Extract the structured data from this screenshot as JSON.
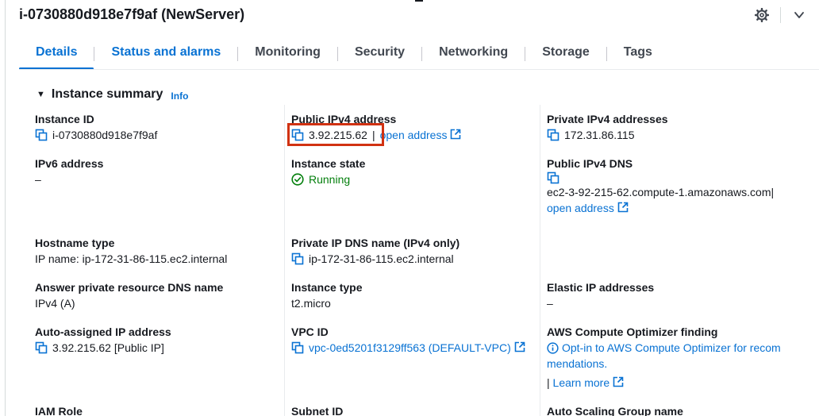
{
  "header": {
    "title": "i-0730880d918e7f9af (NewServer)",
    "settings_icon": "gear-icon",
    "expand_icon": "chevron-down-icon"
  },
  "tabs": [
    {
      "label": "Details",
      "active": true
    },
    {
      "label": "Status and alarms"
    },
    {
      "label": "Monitoring"
    },
    {
      "label": "Security"
    },
    {
      "label": "Networking"
    },
    {
      "label": "Storage"
    },
    {
      "label": "Tags"
    }
  ],
  "summary": {
    "title": "Instance summary",
    "info": "Info"
  },
  "fields": {
    "instance_id": {
      "label": "Instance ID",
      "value": "i-0730880d918e7f9af"
    },
    "public_ipv4": {
      "label": "Public IPv4 address",
      "value": "3.92.215.62",
      "sep": "|",
      "link": "open address"
    },
    "private_ipv4": {
      "label": "Private IPv4 addresses",
      "value": "172.31.86.115"
    },
    "ipv6": {
      "label": "IPv6 address",
      "value": "–"
    },
    "instance_state": {
      "label": "Instance state",
      "value": "Running"
    },
    "public_dns": {
      "label": "Public IPv4 DNS",
      "value": "ec2-3-92-215-62.compute-1.amazonaws.com",
      "sep": "|",
      "link": "open address"
    },
    "hostname_type": {
      "label": "Hostname type",
      "value": "IP name: ip-172-31-86-115.ec2.internal"
    },
    "private_dns": {
      "label": "Private IP DNS name (IPv4 only)",
      "value": "ip-172-31-86-115.ec2.internal"
    },
    "answer_dns": {
      "label": "Answer private resource DNS name",
      "value": "IPv4 (A)"
    },
    "instance_type": {
      "label": "Instance type",
      "value": "t2.micro"
    },
    "elastic_ip": {
      "label": "Elastic IP addresses",
      "value": "–"
    },
    "auto_ip": {
      "label": "Auto-assigned IP address",
      "value": "3.92.215.62 [Public IP]"
    },
    "vpc_id": {
      "label": "VPC ID",
      "value": "vpc-0ed5201f3129ff563 (DEFAULT-VPC)"
    },
    "optimizer": {
      "label": "AWS Compute Optimizer finding",
      "line1": "Opt-in to AWS Compute Optimizer for recom",
      "line2": "mendations.",
      "sep": "|",
      "link": "Learn more"
    },
    "iam_role": {
      "label": "IAM Role"
    },
    "subnet_id": {
      "label": "Subnet ID"
    },
    "asg_name": {
      "label": "Auto Scaling Group name"
    }
  },
  "colors": {
    "link": "#0972d3",
    "success": "#037f0c",
    "highlight": "#d13212"
  }
}
